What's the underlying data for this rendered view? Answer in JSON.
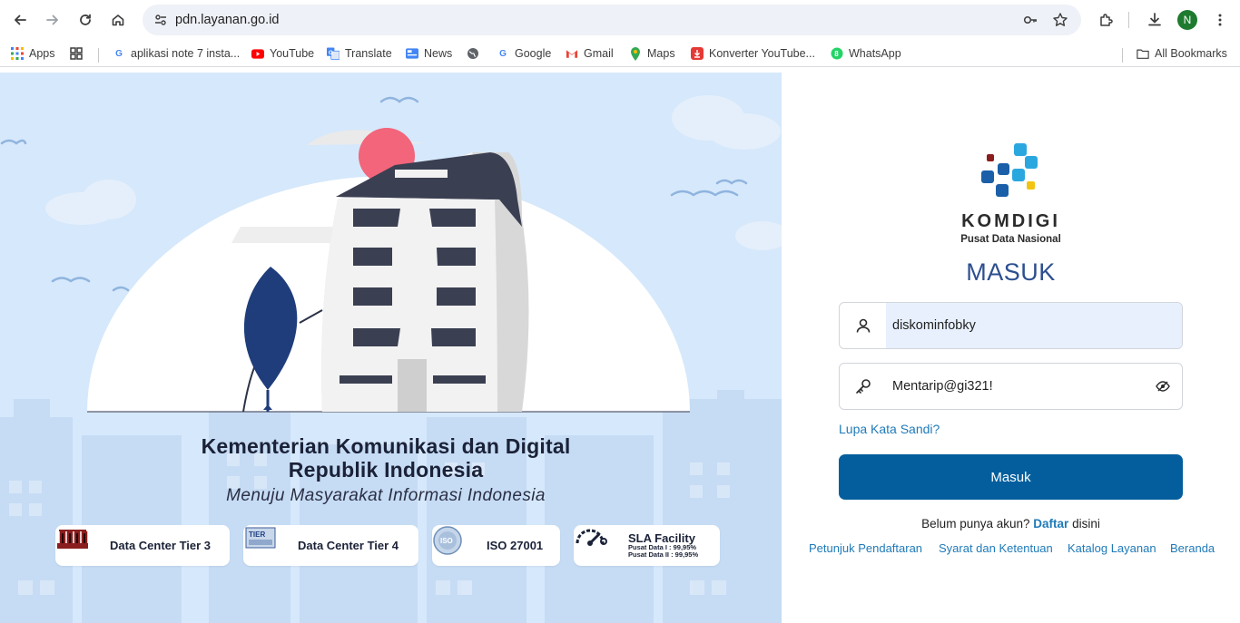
{
  "browser": {
    "url": "pdn.layanan.go.id",
    "profile_initial": "N",
    "bookmarks": [
      {
        "label": "Apps",
        "icon": "apps-grid-icon"
      },
      {
        "label": "aplikasi note 7 insta...",
        "icon": "google-icon"
      },
      {
        "label": "YouTube",
        "icon": "youtube-icon"
      },
      {
        "label": "Translate",
        "icon": "translate-icon"
      },
      {
        "label": "News",
        "icon": "news-icon"
      },
      {
        "label": "Google",
        "icon": "google-icon"
      },
      {
        "label": "Gmail",
        "icon": "gmail-icon"
      },
      {
        "label": "Maps",
        "icon": "maps-icon"
      },
      {
        "label": "Konverter YouTube...",
        "icon": "download-red-icon"
      },
      {
        "label": "WhatsApp",
        "icon": "whatsapp-icon"
      }
    ],
    "all_bookmarks": "All Bookmarks"
  },
  "hero": {
    "title_line1": "Kementerian Komunikasi dan Digital",
    "title_line2": "Republik Indonesia",
    "tagline": "Menuju Masyarakat Informasi Indonesia",
    "badges": [
      {
        "label": "Data Center Tier 3"
      },
      {
        "label": "Data Center Tier 4"
      },
      {
        "label": "ISO 27001"
      }
    ],
    "sla": {
      "title": "SLA Facility",
      "line1": "Pusat Data I : 99,95%",
      "line2": "Pusat Data II : 99,95%"
    }
  },
  "login": {
    "brand_name": "KOMDIGI",
    "brand_sub": "Pusat Data Nasional",
    "title": "MASUK",
    "username_value": "diskominfobky",
    "password_value": "Mentarip@gi321!",
    "forgot_label": "Lupa Kata Sandi?",
    "submit_label": "Masuk",
    "register_prefix": "Belum punya akun?",
    "register_link": "Daftar",
    "register_suffix": "disini",
    "footer_links": [
      "Petunjuk Pendaftaran",
      "Syarat dan Ketentuan",
      "Katalog Layanan",
      "Beranda"
    ]
  },
  "colors": {
    "hero_bg": "#d6e8fb",
    "primary_button": "#045e9d",
    "link": "#1f7ab8",
    "title": "#2d4f8f"
  }
}
